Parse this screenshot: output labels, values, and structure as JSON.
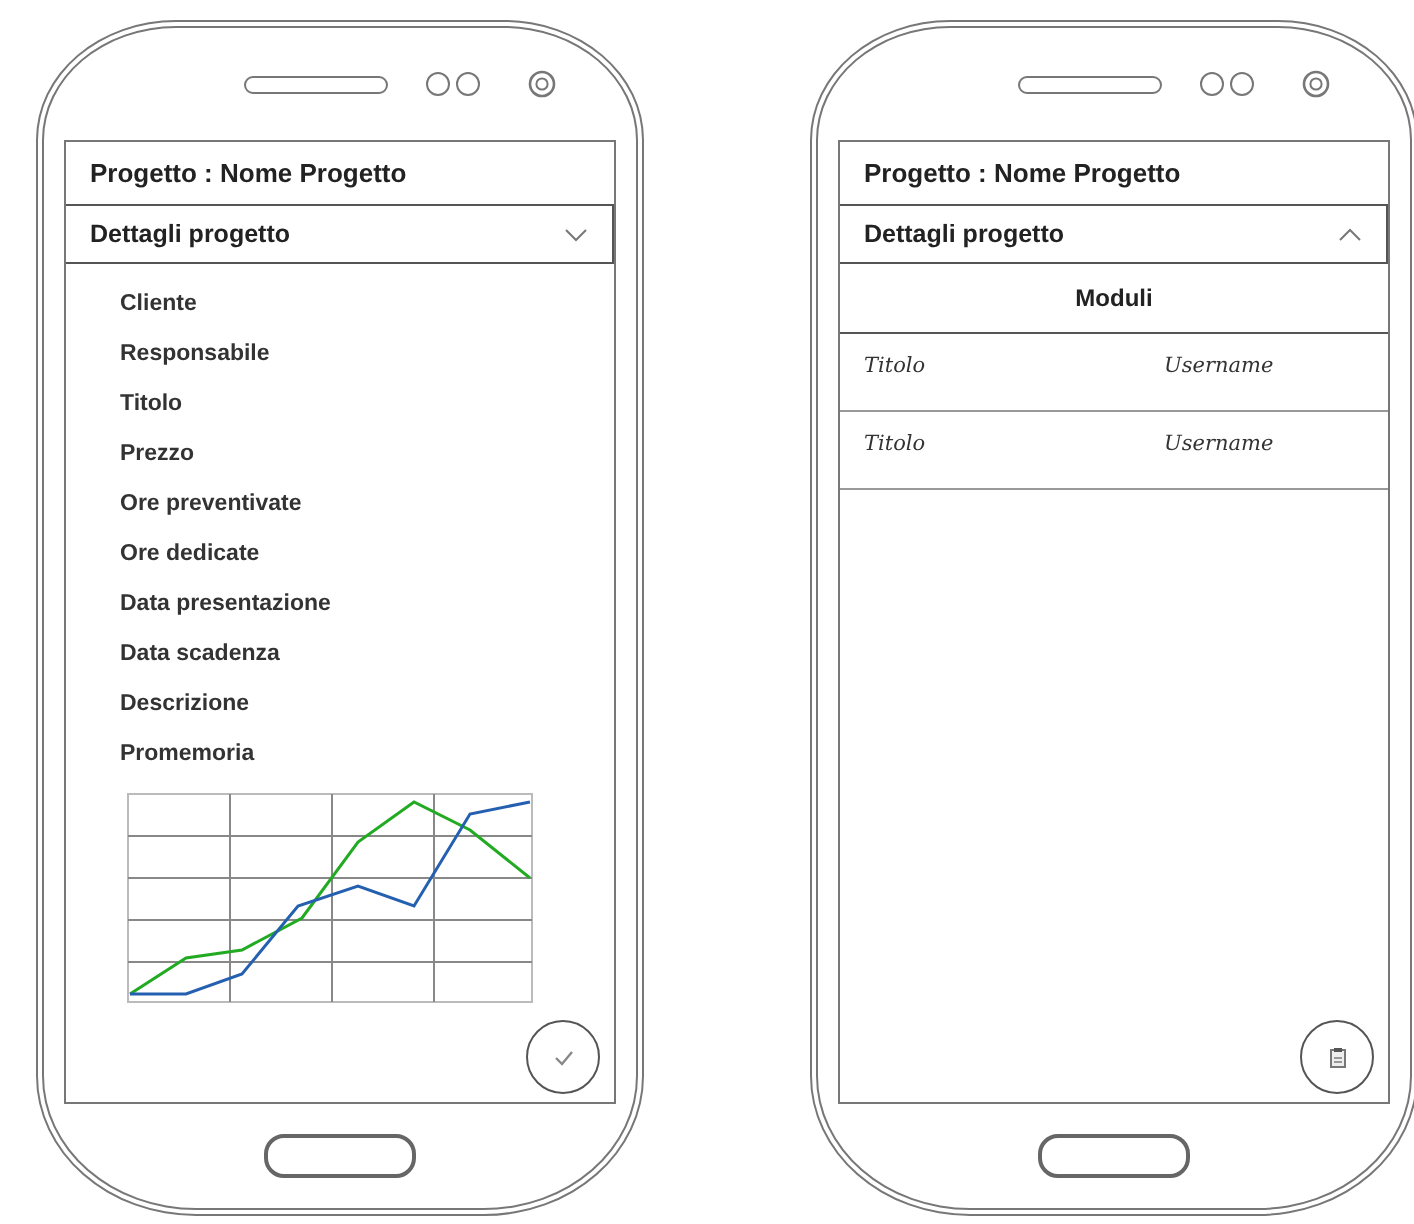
{
  "phones": [
    {
      "title": "Progetto : Nome Progetto",
      "section": {
        "label": "Dettagli progetto",
        "expanded": false
      },
      "fields": [
        "Cliente",
        "Responsabile",
        "Titolo",
        "Prezzo",
        "Ore preventivate",
        "Ore dedicate",
        "Data presentazione",
        "Data scadenza",
        "Descrizione",
        "Promemoria"
      ],
      "fab": {
        "kind": "check"
      }
    },
    {
      "title": "Progetto : Nome Progetto",
      "section": {
        "label": "Dettagli progetto",
        "expanded": true
      },
      "modules": {
        "heading": "Moduli",
        "rows": [
          {
            "title": "Titolo",
            "user": "Username"
          },
          {
            "title": "Titolo",
            "user": "Username"
          }
        ]
      },
      "fab": {
        "kind": "clipboard"
      }
    }
  ]
}
